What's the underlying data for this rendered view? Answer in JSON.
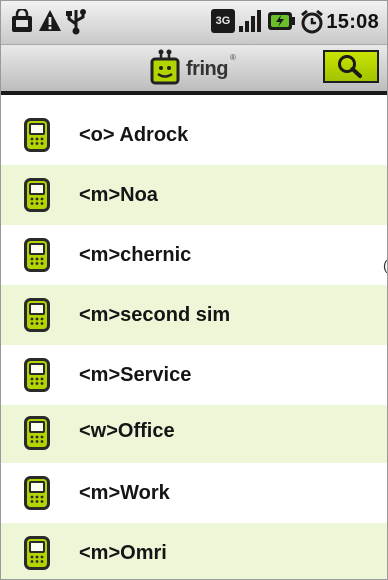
{
  "status_bar": {
    "time": "15:08",
    "network_badge": "3G",
    "icons": [
      "bag-icon",
      "warning-icon",
      "usb-icon",
      "network-3g-icon",
      "signal-icon",
      "battery-charging-icon",
      "alarm-icon"
    ]
  },
  "header": {
    "logo_text": "fring",
    "logo_reg": "®",
    "search_icon": "search-icon",
    "accent_color": "#b4d400"
  },
  "contacts": [
    {
      "label": "<o> Adrock",
      "icon": "mobile-phone-icon"
    },
    {
      "label": "<m>Noa",
      "icon": "mobile-phone-icon"
    },
    {
      "label": "<m>chernic",
      "icon": "mobile-phone-icon"
    },
    {
      "label": "<m>second sim",
      "icon": "mobile-phone-icon"
    },
    {
      "label": "<m>Service",
      "icon": "mobile-phone-icon"
    },
    {
      "label": "<w>Office",
      "icon": "mobile-phone-icon"
    },
    {
      "label": "<m>Work",
      "icon": "mobile-phone-icon"
    },
    {
      "label": "<m>Omri",
      "icon": "mobile-phone-icon"
    }
  ],
  "edge_mark": "("
}
